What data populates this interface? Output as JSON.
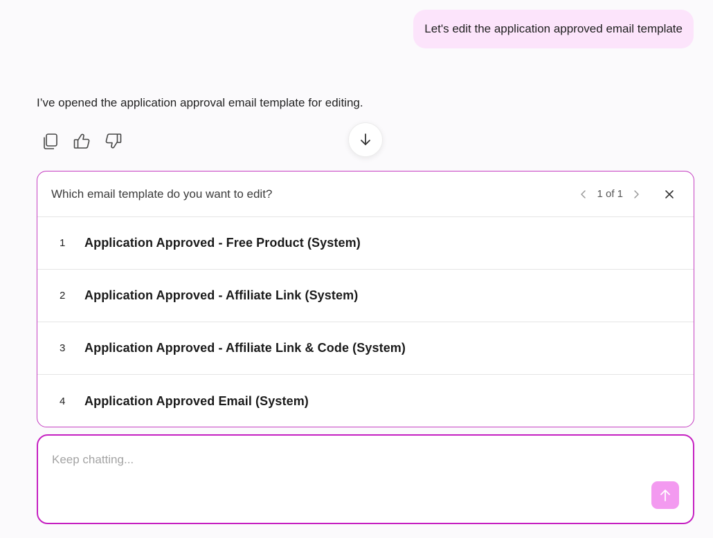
{
  "user_message": "Let's edit the application approved email template",
  "assistant": {
    "message": "I’ve opened the application approval email template for editing.",
    "actions": [
      {
        "icon": "copy-icon"
      },
      {
        "icon": "thumbs-up-icon"
      },
      {
        "icon": "thumbs-down-icon"
      }
    ]
  },
  "scroll_button": {
    "icon": "arrow-down-icon"
  },
  "question": {
    "title": "Which email template do you want to edit?",
    "pager": "1 of 1",
    "options": [
      {
        "num": "1",
        "label": "Application Approved - Free Product (System)"
      },
      {
        "num": "2",
        "label": "Application Approved - Affiliate Link (System)"
      },
      {
        "num": "3",
        "label": "Application Approved - Affiliate Link & Code (System)"
      },
      {
        "num": "4",
        "label": "Application Approved Email (System)"
      }
    ]
  },
  "input": {
    "placeholder": "Keep chatting...",
    "value": ""
  },
  "colors": {
    "accent": "#c51fc1",
    "bubble": "#fce4fb",
    "send": "#f39af0"
  }
}
